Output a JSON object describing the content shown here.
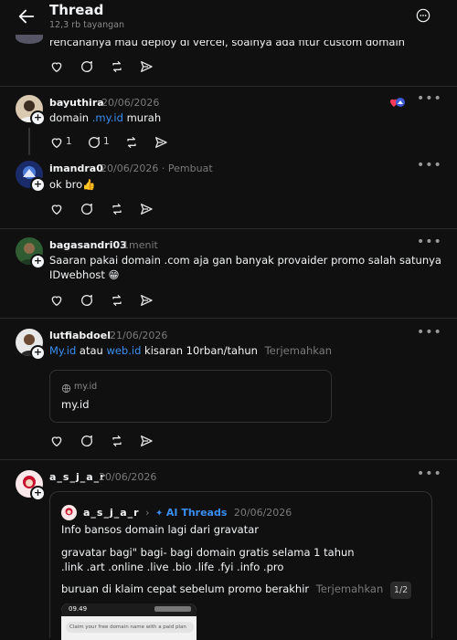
{
  "header": {
    "title": "Thread",
    "subtitle": "12,3 rb tayangan"
  },
  "top_post": {
    "text": "rencananya mau deploy di vercel, soalnya ada fitur custom domain"
  },
  "posts": {
    "p1": {
      "username": "bayuthira",
      "date": "20/06/2026",
      "text_pre": "domain ",
      "text_link": ".my.id",
      "text_post": " murah",
      "like_count": "1",
      "reply_count": "1"
    },
    "p2": {
      "username": "imandra0",
      "date": "20/06/2026",
      "author_tag": "· Pembuat",
      "text": "ok bro👍"
    },
    "p3": {
      "username": "bagasandri03",
      "date": "1menit",
      "line1": "Saaran pakai domain .com aja gan banyak provaider promo salah satunya",
      "line2": "IDwebhost 😁"
    },
    "p4": {
      "username": "lutfiabdoel",
      "date": "21/06/2026",
      "link1": "My.id",
      "mid": " atau ",
      "link2": "web.id",
      "tail": " kisaran 10rban/tahun",
      "translate": "Terjemahkan",
      "card_domain": "my.id",
      "card_title": "my.id"
    },
    "p5": {
      "username": "a_s_j_a_r",
      "date": "20/06/2026",
      "quote": {
        "username": "a_s_j_a_r",
        "separator": "›",
        "topic": "AI Threads",
        "date": "20/06/2026",
        "line1": "Info bansos domain lagi dari gravatar",
        "line2": "gravatar bagi\" bagi- bagi domain gratis selama 1 tahun",
        "line3": ".link .art .online .live .bio .life .fyi .info .pro",
        "line4": "buruan di klaim cepat sebelum promo berakhir",
        "translate": "Terjemahkan",
        "page_badge": "1/2",
        "phone_time": "09.49",
        "phone_text": "Claim your free domain name with a paid plan"
      }
    }
  },
  "colors": {
    "background": "#101010",
    "link": "#3a8ef0",
    "muted": "#7a7a7a",
    "divider": "#2a2a2a"
  }
}
